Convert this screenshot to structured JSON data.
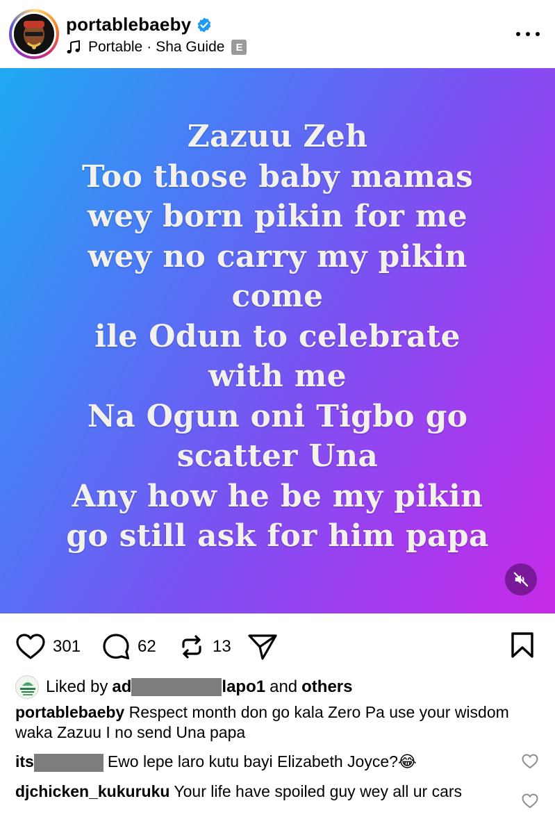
{
  "header": {
    "username": "portablebaeby",
    "music": {
      "artist": "Portable",
      "separator": "·",
      "song": "Sha Guide",
      "explicit_badge": "E"
    }
  },
  "post": {
    "lines": [
      "Zazuu Zeh",
      "Too those baby mamas",
      "wey born pikin for me",
      "wey no carry my pikin",
      "come",
      "ile Odun to celebrate",
      "with me",
      "Na Ogun oni Tigbo go",
      "scatter Una",
      "Any how he be my pikin",
      "go still ask for him papa"
    ],
    "gradient": {
      "start": "#1faaf2",
      "middle": "#7a52f2",
      "end": "#c62ae6"
    },
    "mute_icon": "speaker-muted-icon"
  },
  "actions": {
    "likes": "301",
    "comments": "62",
    "reposts": "13"
  },
  "liked_by": {
    "prefix": "Liked by",
    "user_start": "ad",
    "user_end": "lapo1",
    "middle": "and",
    "others": "others"
  },
  "comments": [
    {
      "user": "portablebaeby",
      "text": "Respect month don go kala Zero Pa use your wisdom waka Zazuu I no send Una papa"
    },
    {
      "user": "its",
      "text": "Ewo lepe laro kutu bayi Elizabeth Joyce?😂"
    },
    {
      "user": "djchicken_kukuruku",
      "text": "Your life have spoiled guy  wey all ur cars"
    }
  ]
}
